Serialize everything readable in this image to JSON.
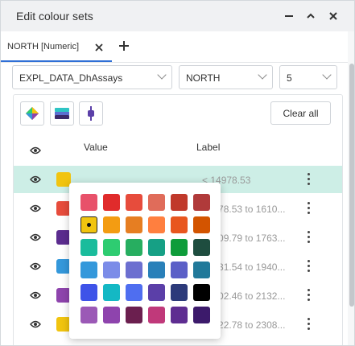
{
  "window": {
    "title": "Edit colour sets"
  },
  "tabs": [
    {
      "label": "NORTH [Numeric]"
    }
  ],
  "selects": {
    "table": "EXPL_DATA_DhAssays",
    "column": "NORTH",
    "classes": "5"
  },
  "toolbar": {
    "clear_all": "Clear all"
  },
  "columns": {
    "value": "Value",
    "label": "Label"
  },
  "rows": [
    {
      "color": "#f1c40f",
      "label": "< 14978.53",
      "selected": true
    },
    {
      "color": "#e74c3c",
      "label": "14978.53 to 1610..."
    },
    {
      "color": "#5b2c8f",
      "label": "16109.79 to 1763..."
    },
    {
      "color": "#3498db",
      "label": "17631.54 to 1940..."
    },
    {
      "color": "#8e44ad",
      "label": "19402.46 to 2132..."
    },
    {
      "color": "#f1c40f",
      "label": "21322.78 to 2308..."
    }
  ],
  "palette": {
    "selected": "#f1c40f",
    "rows": [
      [
        "#e8516a",
        "#e02b2b",
        "#e74c3c",
        "#e06c5a",
        "#c0392b",
        "#b03a3a"
      ],
      [
        "#f1c40f",
        "#f39c12",
        "#e67e22",
        "#ff7f3f",
        "#e8561f",
        "#d35400"
      ],
      [
        "#1abc9c",
        "#2ecc71",
        "#27ae60",
        "#16a085",
        "#0e9c3a",
        "#1e4d3f"
      ],
      [
        "#3498db",
        "#7b8ce8",
        "#6c6fd0",
        "#2980b9",
        "#5b5fc7",
        "#21799a"
      ],
      [
        "#3e53e8",
        "#14b8c4",
        "#4f6ef0",
        "#5b3fa8",
        "#2c3a7a",
        "#000000"
      ],
      [
        "#9b59b6",
        "#8e44ad",
        "#6b1f4f",
        "#c0397a",
        "#5e2d91",
        "#3c1a6b"
      ]
    ]
  }
}
